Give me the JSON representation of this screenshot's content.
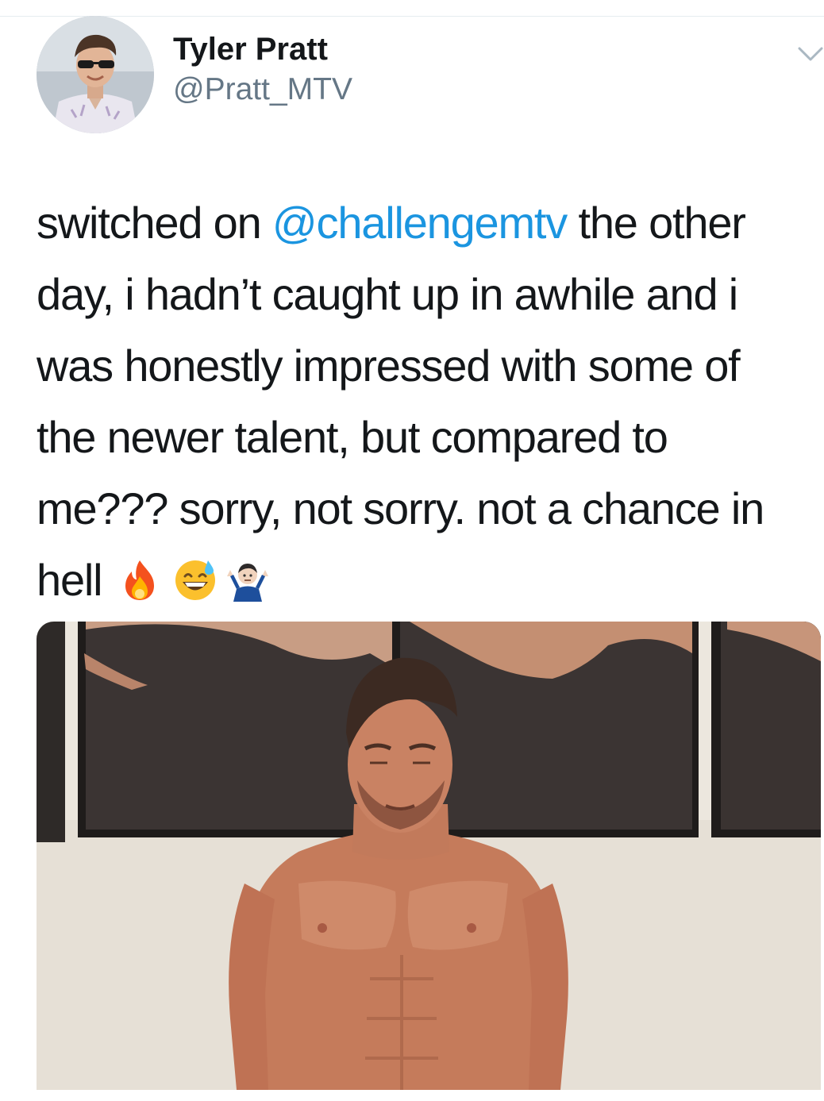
{
  "author": {
    "display_name": "Tyler Pratt",
    "handle": "@Pratt_MTV",
    "avatar_icon": "profile-photo"
  },
  "tweet": {
    "lines": [
      {
        "before": "switched on ",
        "mention": "@challengemtv",
        "after": " the other"
      },
      {
        "text": "day, i hadn’t caught up in awhile and i"
      },
      {
        "text": "was honestly impressed with some of"
      },
      {
        "text": "the newer talent, but compared to"
      },
      {
        "text": "me??? sorry, not sorry. not a chance in"
      },
      {
        "text": "hell"
      }
    ],
    "emoji": [
      "fire-emoji",
      "grinning-sweat-emoji",
      "man-shrugging-emoji"
    ]
  },
  "media": {
    "type": "photo"
  },
  "icons": {
    "menu": "chevron-down-icon"
  },
  "colors": {
    "text": "#14171a",
    "secondary": "#657786",
    "link": "#1b95e0",
    "chevron": "#aab8c2"
  }
}
